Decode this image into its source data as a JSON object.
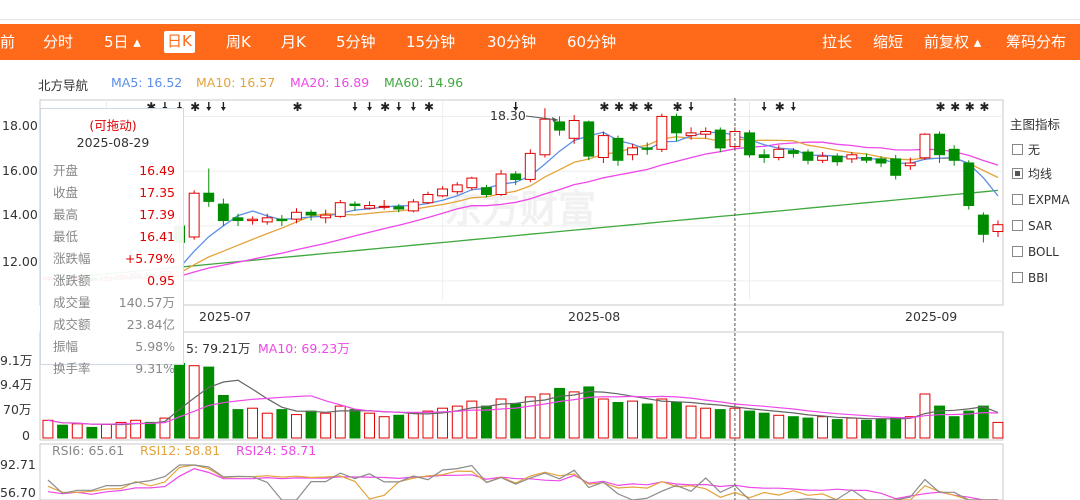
{
  "toolbar": {
    "left": "前",
    "periods": [
      "分时",
      "5日 ▴",
      "日K",
      "周K",
      "月K",
      "5分钟",
      "15分钟",
      "30分钟",
      "60分钟"
    ],
    "active_period": "日K",
    "actions": [
      "拉长",
      "缩短",
      "前复权 ▴",
      "筹码分布"
    ]
  },
  "legend": {
    "name": "北方导航",
    "ma5": "MA5: 16.52",
    "ma10": "MA10: 16.57",
    "ma20": "MA20: 16.89",
    "ma60": "MA60: 14.96"
  },
  "price_axis": [
    "18.00",
    "16.00",
    "14.00",
    "12.00"
  ],
  "date_axis": [
    "2025-07",
    "2025-08",
    "2025-09"
  ],
  "peak_label": "18.30",
  "watermark": "东方财富",
  "tooltip": {
    "title": "(可拖动)",
    "date": "2025-08-29",
    "rows": [
      {
        "k": "开盘",
        "v": "16.49",
        "c": "#e10000"
      },
      {
        "k": "收盘",
        "v": "17.35",
        "c": "#e10000"
      },
      {
        "k": "最高",
        "v": "17.39",
        "c": "#e10000"
      },
      {
        "k": "最低",
        "v": "16.41",
        "c": "#e10000"
      },
      {
        "k": "涨跌幅",
        "v": "+5.79%",
        "c": "#e10000"
      },
      {
        "k": "涨跌额",
        "v": "0.95",
        "c": "#e10000"
      },
      {
        "k": "成交量",
        "v": "140.57万",
        "c": "#888888"
      },
      {
        "k": "成交额",
        "v": "23.84亿",
        "c": "#888888"
      },
      {
        "k": "振幅",
        "v": "5.98%",
        "c": "#888888"
      },
      {
        "k": "换手率",
        "v": "9.31%",
        "c": "#888888"
      }
    ]
  },
  "volume": {
    "legend_ma5": "5: 79.21万",
    "legend_ma10": "MA10: 69.23万",
    "axis": [
      "9.1万",
      "9.4万",
      "70万",
      "0"
    ]
  },
  "rsi": {
    "rsi6": "RSI6: 65.61",
    "rsi12": "RSI12: 58.81",
    "rsi24": "RSI24: 58.71",
    "axis": [
      "92.71",
      "56.70"
    ]
  },
  "indicator_panel": {
    "title": "主图指标",
    "items": [
      {
        "label": "无",
        "checked": false
      },
      {
        "label": "均线",
        "checked": true
      },
      {
        "label": "EXPMA",
        "checked": false
      },
      {
        "label": "SAR",
        "checked": false
      },
      {
        "label": "BOLL",
        "checked": false
      },
      {
        "label": "BBI",
        "checked": false
      }
    ]
  },
  "colors": {
    "up": "#e10000",
    "down": "#008c00",
    "ma5": "#5b8fe8",
    "ma10": "#e3a33a",
    "ma20": "#ee48e8",
    "ma60": "#3fa83f",
    "toolbar": "#ff6a1a"
  },
  "chart_data": {
    "type": "candlestick",
    "ylim": [
      11.3,
      18.6
    ],
    "start_date": "2025-06-25",
    "end_date": "2025-09-05",
    "highlight_date": "2025-08-29",
    "candles": [
      {
        "o": 12.05,
        "c": 12.12,
        "h": 12.18,
        "l": 11.98
      },
      {
        "o": 12.12,
        "c": 12.05,
        "h": 12.18,
        "l": 11.97
      },
      {
        "o": 12.05,
        "c": 12.1,
        "h": 12.16,
        "l": 11.99
      },
      {
        "o": 12.1,
        "c": 12.02,
        "h": 12.15,
        "l": 11.96
      },
      {
        "o": 12.02,
        "c": 12.12,
        "h": 12.2,
        "l": 11.98
      },
      {
        "o": 12.1,
        "c": 12.18,
        "h": 12.26,
        "l": 12.04
      },
      {
        "o": 12.18,
        "c": 12.25,
        "h": 12.34,
        "l": 12.1
      },
      {
        "o": 12.25,
        "c": 12.2,
        "h": 12.33,
        "l": 12.12
      },
      {
        "o": 12.2,
        "c": 12.35,
        "h": 12.4,
        "l": 12.12
      },
      {
        "o": 14.0,
        "c": 13.4,
        "h": 14.35,
        "l": 13.1
      },
      {
        "o": 13.6,
        "c": 15.2,
        "h": 15.3,
        "l": 13.5
      },
      {
        "o": 15.2,
        "c": 14.9,
        "h": 16.1,
        "l": 14.7
      },
      {
        "o": 14.8,
        "c": 14.2,
        "h": 15.0,
        "l": 14.0
      },
      {
        "o": 14.3,
        "c": 14.2,
        "h": 14.45,
        "l": 14.0
      },
      {
        "o": 14.2,
        "c": 14.25,
        "h": 14.35,
        "l": 14.05
      },
      {
        "o": 14.15,
        "c": 14.3,
        "h": 14.45,
        "l": 14.05
      },
      {
        "o": 14.25,
        "c": 14.2,
        "h": 14.4,
        "l": 14.0
      },
      {
        "o": 14.25,
        "c": 14.5,
        "h": 14.65,
        "l": 14.1
      },
      {
        "o": 14.5,
        "c": 14.4,
        "h": 14.6,
        "l": 14.2
      },
      {
        "o": 14.3,
        "c": 14.4,
        "h": 14.6,
        "l": 14.1
      },
      {
        "o": 14.35,
        "c": 14.85,
        "h": 14.95,
        "l": 14.3
      },
      {
        "o": 14.8,
        "c": 14.75,
        "h": 14.9,
        "l": 14.55
      },
      {
        "o": 14.65,
        "c": 14.75,
        "h": 14.9,
        "l": 14.6
      },
      {
        "o": 14.72,
        "c": 14.72,
        "h": 14.95,
        "l": 14.6
      },
      {
        "o": 14.7,
        "c": 14.62,
        "h": 14.8,
        "l": 14.5
      },
      {
        "o": 14.55,
        "c": 14.88,
        "h": 14.98,
        "l": 14.5
      },
      {
        "o": 14.85,
        "c": 15.15,
        "h": 15.25,
        "l": 14.8
      },
      {
        "o": 15.1,
        "c": 15.35,
        "h": 15.45,
        "l": 15.05
      },
      {
        "o": 15.25,
        "c": 15.5,
        "h": 15.6,
        "l": 15.15
      },
      {
        "o": 15.4,
        "c": 15.75,
        "h": 15.8,
        "l": 15.3
      },
      {
        "o": 15.4,
        "c": 15.15,
        "h": 15.5,
        "l": 15.05
      },
      {
        "o": 15.15,
        "c": 15.9,
        "h": 16.05,
        "l": 15.1
      },
      {
        "o": 15.9,
        "c": 15.7,
        "h": 16.0,
        "l": 15.5
      },
      {
        "o": 15.7,
        "c": 16.65,
        "h": 16.8,
        "l": 15.6
      },
      {
        "o": 16.6,
        "c": 17.9,
        "h": 18.3,
        "l": 16.5
      },
      {
        "o": 17.8,
        "c": 17.5,
        "h": 18.0,
        "l": 17.3
      },
      {
        "o": 17.2,
        "c": 17.85,
        "h": 18.05,
        "l": 17.0
      },
      {
        "o": 17.8,
        "c": 16.55,
        "h": 17.85,
        "l": 16.4
      },
      {
        "o": 16.5,
        "c": 17.3,
        "h": 17.45,
        "l": 16.3
      },
      {
        "o": 17.2,
        "c": 16.4,
        "h": 17.3,
        "l": 16.2
      },
      {
        "o": 16.6,
        "c": 16.85,
        "h": 17.0,
        "l": 16.4
      },
      {
        "o": 16.85,
        "c": 16.8,
        "h": 17.05,
        "l": 16.6
      },
      {
        "o": 16.8,
        "c": 18.0,
        "h": 18.1,
        "l": 16.7
      },
      {
        "o": 18.0,
        "c": 17.4,
        "h": 18.1,
        "l": 17.1
      },
      {
        "o": 17.3,
        "c": 17.4,
        "h": 17.6,
        "l": 17.15
      },
      {
        "o": 17.35,
        "c": 17.45,
        "h": 17.6,
        "l": 17.2
      },
      {
        "o": 17.5,
        "c": 16.85,
        "h": 17.6,
        "l": 16.7
      },
      {
        "o": 16.9,
        "c": 17.45,
        "h": 17.6,
        "l": 16.8
      },
      {
        "o": 17.4,
        "c": 16.6,
        "h": 17.5,
        "l": 16.5
      },
      {
        "o": 16.6,
        "c": 16.5,
        "h": 16.8,
        "l": 16.3
      },
      {
        "o": 16.5,
        "c": 16.8,
        "h": 16.95,
        "l": 16.4
      },
      {
        "o": 16.75,
        "c": 16.65,
        "h": 16.85,
        "l": 16.5
      },
      {
        "o": 16.7,
        "c": 16.4,
        "h": 16.8,
        "l": 16.25
      },
      {
        "o": 16.4,
        "c": 16.55,
        "h": 16.7,
        "l": 16.3
      },
      {
        "o": 16.55,
        "c": 16.35,
        "h": 16.65,
        "l": 16.2
      },
      {
        "o": 16.45,
        "c": 16.6,
        "h": 16.7,
        "l": 16.3
      },
      {
        "o": 16.5,
        "c": 16.4,
        "h": 16.65,
        "l": 16.3
      },
      {
        "o": 16.45,
        "c": 16.3,
        "h": 16.55,
        "l": 16.15
      },
      {
        "o": 16.45,
        "c": 15.85,
        "h": 16.6,
        "l": 15.7
      },
      {
        "o": 16.2,
        "c": 16.3,
        "h": 16.5,
        "l": 16.05
      },
      {
        "o": 16.49,
        "c": 17.35,
        "h": 17.39,
        "l": 16.41
      },
      {
        "o": 17.35,
        "c": 16.6,
        "h": 17.45,
        "l": 16.3
      },
      {
        "o": 16.8,
        "c": 16.4,
        "h": 16.95,
        "l": 16.2
      },
      {
        "o": 16.3,
        "c": 14.75,
        "h": 16.4,
        "l": 14.6
      },
      {
        "o": 14.4,
        "c": 13.7,
        "h": 14.5,
        "l": 13.4
      },
      {
        "o": 13.8,
        "c": 14.05,
        "h": 14.2,
        "l": 13.6
      }
    ],
    "volume": [
      25,
      18,
      20,
      15,
      19,
      22,
      25,
      22,
      28,
      105,
      102,
      100,
      60,
      40,
      42,
      35,
      40,
      33,
      38,
      35,
      45,
      40,
      35,
      30,
      32,
      35,
      38,
      42,
      45,
      52,
      45,
      55,
      48,
      58,
      62,
      70,
      65,
      72,
      55,
      50,
      52,
      48,
      55,
      50,
      45,
      42,
      40,
      42,
      38,
      35,
      32,
      30,
      28,
      30,
      26,
      28,
      25,
      27,
      28,
      30,
      62,
      45,
      30,
      38,
      45,
      22
    ],
    "ma60": [
      12.05,
      12.1,
      12.15,
      12.2,
      12.25,
      12.3,
      12.35,
      12.4,
      12.45,
      12.5,
      12.55,
      12.6,
      12.65,
      12.7,
      12.75,
      12.8,
      12.85,
      12.9,
      12.95,
      13.0,
      13.05,
      13.1,
      13.15,
      13.2,
      13.25,
      13.3,
      13.35,
      13.4,
      13.45,
      13.5,
      13.55,
      13.6,
      13.65,
      13.7,
      13.75,
      13.8,
      13.85,
      13.9,
      13.95,
      14.0,
      14.05,
      14.1,
      14.15,
      14.2,
      14.25,
      14.3,
      14.35,
      14.4,
      14.45,
      14.5,
      14.55,
      14.6,
      14.65,
      14.7,
      14.75,
      14.8,
      14.85,
      14.9,
      14.95,
      15.0,
      15.05,
      15.1,
      15.15,
      15.2,
      15.25,
      15.3
    ]
  }
}
